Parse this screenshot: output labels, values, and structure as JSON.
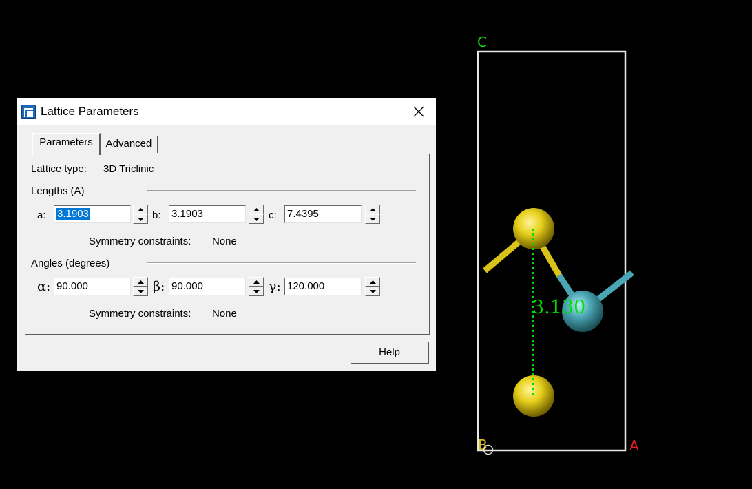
{
  "dialog": {
    "title": "Lattice Parameters",
    "tabs": [
      {
        "label": "Parameters",
        "active": true
      },
      {
        "label": "Advanced",
        "active": false
      }
    ],
    "lattice_type_label": "Lattice type:",
    "lattice_type_value": "3D Triclinic",
    "lengths": {
      "section_label": "Lengths (A)",
      "a_label": "a:",
      "a_value": "3.1903",
      "b_label": "b:",
      "b_value": "3.1903",
      "c_label": "c:",
      "c_value": "7.4395",
      "symmetry_label": "Symmetry constraints:",
      "symmetry_value": "None"
    },
    "angles": {
      "section_label": "Angles (degrees)",
      "alpha_label": "α:",
      "alpha_value": "90.000",
      "beta_label": "β:",
      "beta_value": "90.000",
      "gamma_label": "γ:",
      "gamma_value": "120.000",
      "symmetry_label": "Symmetry constraints:",
      "symmetry_value": "None"
    },
    "help_label": "Help"
  },
  "viewer": {
    "axis_c": "C",
    "axis_a": "A",
    "axis_b": "B",
    "distance_label": "3.130",
    "colors": {
      "background": "#000000",
      "cell_edge": "#e6e6e6",
      "axis_c": "#22cc22",
      "axis_a": "#e02020",
      "axis_b": "#d8c020",
      "atom_s": "#e6cf1a",
      "atom_mo": "#4aa6b4",
      "distance": "#00dd00"
    }
  }
}
